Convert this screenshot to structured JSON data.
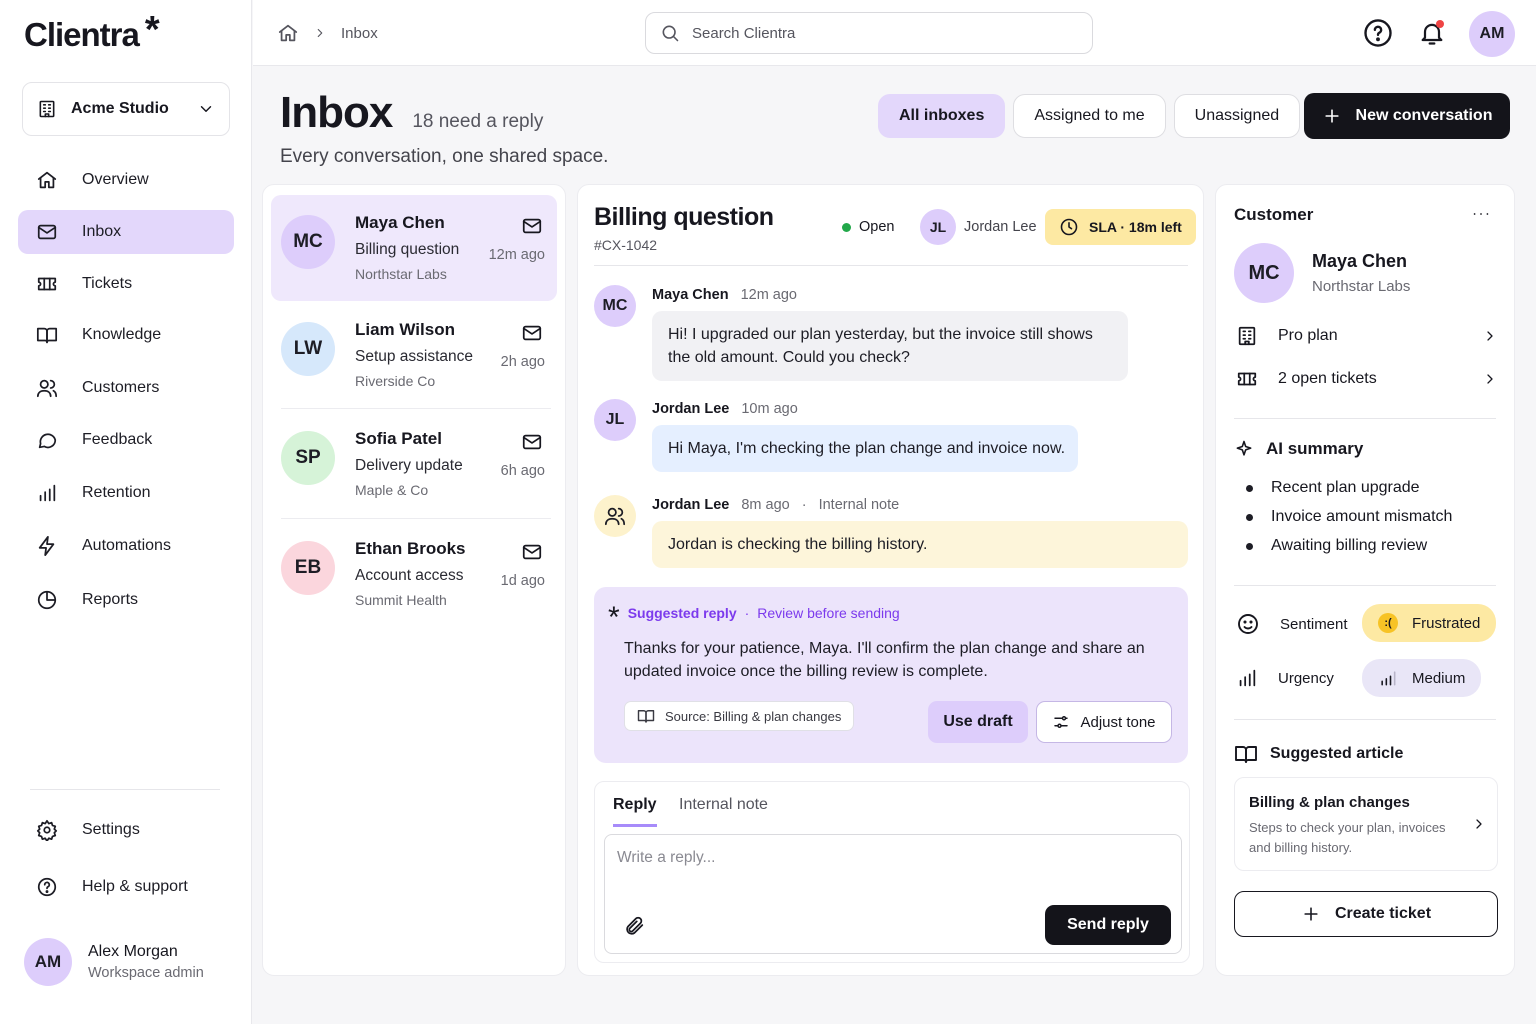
{
  "app": {
    "name": "Clientra",
    "logo_mark": "*"
  },
  "workspace": {
    "name": "Acme Studio"
  },
  "nav": [
    {
      "label": "Overview",
      "icon": "home-icon"
    },
    {
      "label": "Inbox",
      "icon": "mail-icon",
      "active": true
    },
    {
      "label": "Tickets",
      "icon": "ticket-icon"
    },
    {
      "label": "Knowledge",
      "icon": "book-icon"
    },
    {
      "label": "Customers",
      "icon": "users-icon"
    },
    {
      "label": "Feedback",
      "icon": "chat-bubble-icon"
    },
    {
      "label": "Retention",
      "icon": "bar-chart-icon"
    },
    {
      "label": "Automations",
      "icon": "lightning-icon"
    },
    {
      "label": "Reports",
      "icon": "pie-chart-icon"
    }
  ],
  "nav_bottom": [
    {
      "label": "Settings",
      "icon": "gear-icon"
    },
    {
      "label": "Help & support",
      "icon": "help-icon"
    }
  ],
  "user": {
    "initials": "AM",
    "name": "Alex Morgan",
    "role": "Workspace admin"
  },
  "topbar": {
    "breadcrumb": "Inbox",
    "search_placeholder": "Search Clientra",
    "avatar_initials": "AM"
  },
  "header": {
    "title": "Inbox",
    "count": "18 need a reply",
    "subtitle": "Every conversation, one shared space.",
    "filters": [
      "All inboxes",
      "Assigned to me",
      "Unassigned"
    ],
    "new_conversation": "New conversation"
  },
  "conversations": [
    {
      "initials": "MC",
      "name": "Maya Chen",
      "subject": "Billing question",
      "org": "Northstar Labs",
      "time": "12m ago"
    },
    {
      "initials": "LW",
      "name": "Liam Wilson",
      "subject": "Setup assistance",
      "org": "Riverside Co",
      "time": "2h ago"
    },
    {
      "initials": "SP",
      "name": "Sofia Patel",
      "subject": "Delivery update",
      "org": "Maple & Co",
      "time": "6h ago"
    },
    {
      "initials": "EB",
      "name": "Ethan Brooks",
      "subject": "Account access",
      "org": "Summit Health",
      "time": "1d ago"
    }
  ],
  "chat": {
    "title": "Billing question",
    "id": "#CX-1042",
    "status": "Open",
    "assignee_initials": "JL",
    "assignee": "Jordan Lee",
    "sla": "SLA · 18m left",
    "messages": [
      {
        "initials": "MC",
        "author": "Maya Chen",
        "time": "12m ago",
        "text": "Hi! I upgraded our plan yesterday, but the invoice still shows the old amount. Could you check?"
      },
      {
        "initials": "JL",
        "author": "Jordan Lee",
        "time": "10m ago",
        "text": "Hi Maya, I'm checking the plan change and invoice now."
      },
      {
        "author": "Jordan Lee",
        "time": "8m ago",
        "tag": "Internal note",
        "text": "Jordan is checking the billing history."
      }
    ],
    "suggested": {
      "label": "Suggested reply",
      "sublabel": "Review before sending",
      "text": "Thanks for your patience, Maya. I'll confirm the plan change and share an updated invoice once the billing review is complete.",
      "source": "Source: Billing & plan changes",
      "use_draft": "Use draft",
      "adjust_tone": "Adjust tone"
    },
    "reply": {
      "tabs": [
        "Reply",
        "Internal note"
      ],
      "placeholder": "Write a reply...",
      "send": "Send reply"
    }
  },
  "customer": {
    "heading": "Customer",
    "initials": "MC",
    "name": "Maya Chen",
    "org": "Northstar Labs",
    "plan": "Pro plan",
    "tickets": "2 open tickets",
    "ai_title": "AI summary",
    "ai_points": [
      "Recent plan upgrade",
      "Invoice amount mismatch",
      "Awaiting billing review"
    ],
    "sentiment_label": "Sentiment",
    "sentiment_value": "Frustrated",
    "urgency_label": "Urgency",
    "urgency_value": "Medium",
    "article_heading": "Suggested article",
    "article_title": "Billing & plan changes",
    "article_desc": "Steps to check your plan, invoices and billing history.",
    "create_ticket": "Create ticket"
  },
  "colors": {
    "accent": "#e3d7fb",
    "accent_strong": "#7c3aed",
    "dark": "#14141a",
    "sla": "#fde9a3",
    "note": "#fdf5da",
    "status_open": "#22a84a"
  }
}
